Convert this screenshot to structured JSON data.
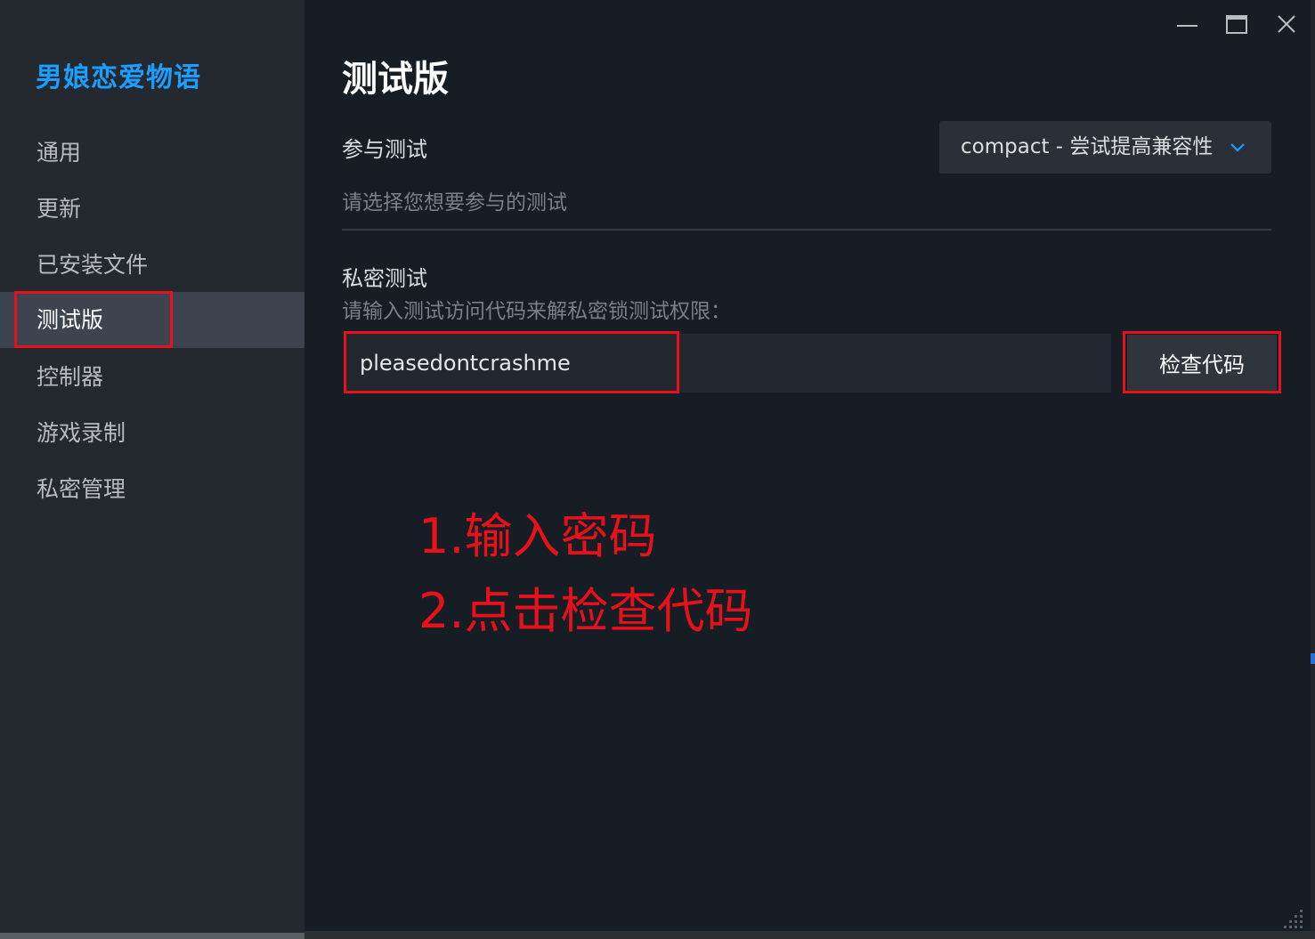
{
  "sidebar": {
    "game_title": "男娘恋爱物语",
    "items": [
      {
        "label": "通用"
      },
      {
        "label": "更新"
      },
      {
        "label": "已安装文件"
      },
      {
        "label": "测试版"
      },
      {
        "label": "控制器"
      },
      {
        "label": "游戏录制"
      },
      {
        "label": "私密管理"
      }
    ],
    "active_item": "测试版"
  },
  "window_controls": {
    "icons": [
      "minimize-icon",
      "maximize-icon",
      "close-icon"
    ]
  },
  "main": {
    "title": "测试版",
    "beta_section": {
      "label": "参与测试",
      "description": "请选择您想要参与的测试",
      "selected_option": "compact - 尝试提高兼容性"
    },
    "private_section": {
      "label": "私密测试",
      "description": "请输入测试访问代码来解私密锁测试权限：",
      "code_value": "pleasedontcrashme",
      "check_button_label": "检查代码"
    }
  },
  "annotations": {
    "step1": "1.输入密码",
    "step2": "2.点击检查代码"
  },
  "colors": {
    "accent": "#1a9fff",
    "annotation": "#e8111a",
    "background": "#171d25",
    "sidebar": "#24282f"
  }
}
